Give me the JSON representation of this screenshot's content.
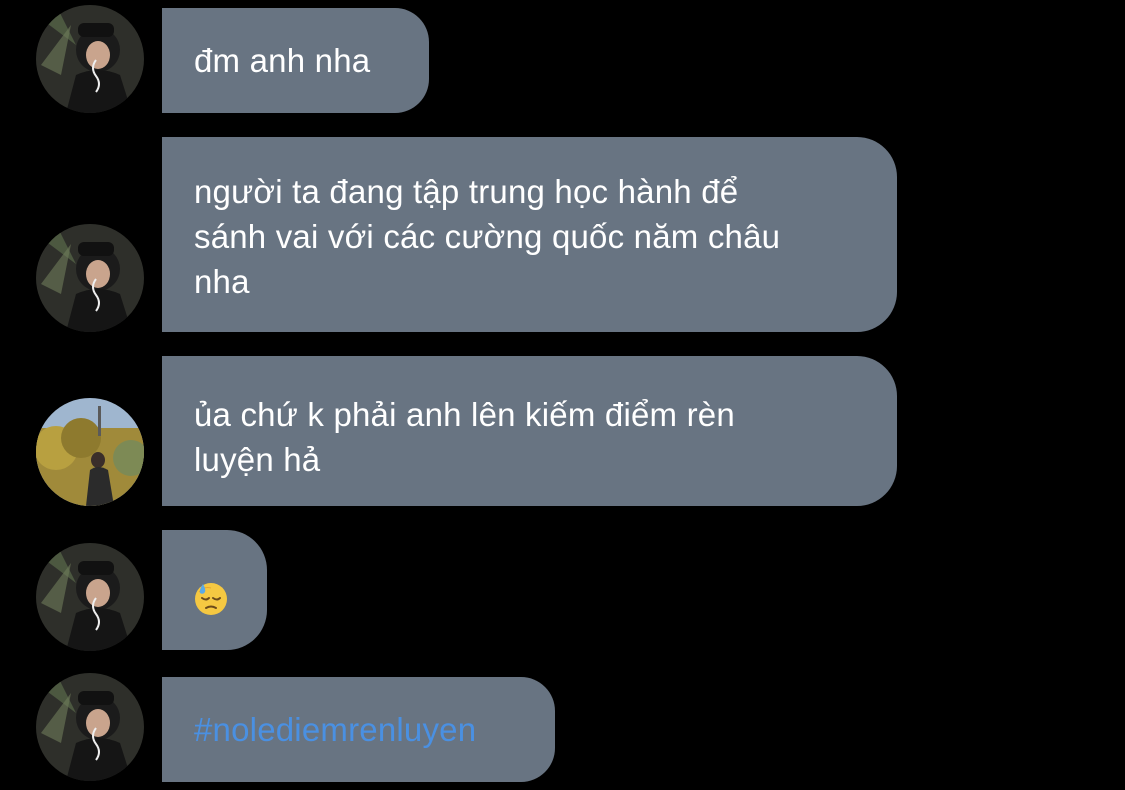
{
  "chat": {
    "messages": [
      {
        "sender": "friend",
        "lines": [
          "đm anh nha"
        ]
      },
      {
        "sender": "friend",
        "lines": [
          "người ta đang tập trung học hành để",
          "sánh vai với các cường quốc năm châu",
          "nha"
        ]
      },
      {
        "sender": "me",
        "lines": [
          "ủa chứ k phải anh lên kiếm điểm rèn",
          "luyện hả"
        ]
      },
      {
        "sender": "friend",
        "emoji": "downcast-face-with-sweat"
      },
      {
        "sender": "friend",
        "hashtag": "#nolediemrenluyen"
      }
    ]
  },
  "colors": {
    "background": "#000000",
    "bubble": "#687482",
    "text": "#ffffff",
    "hashtag": "#4a90e2"
  }
}
